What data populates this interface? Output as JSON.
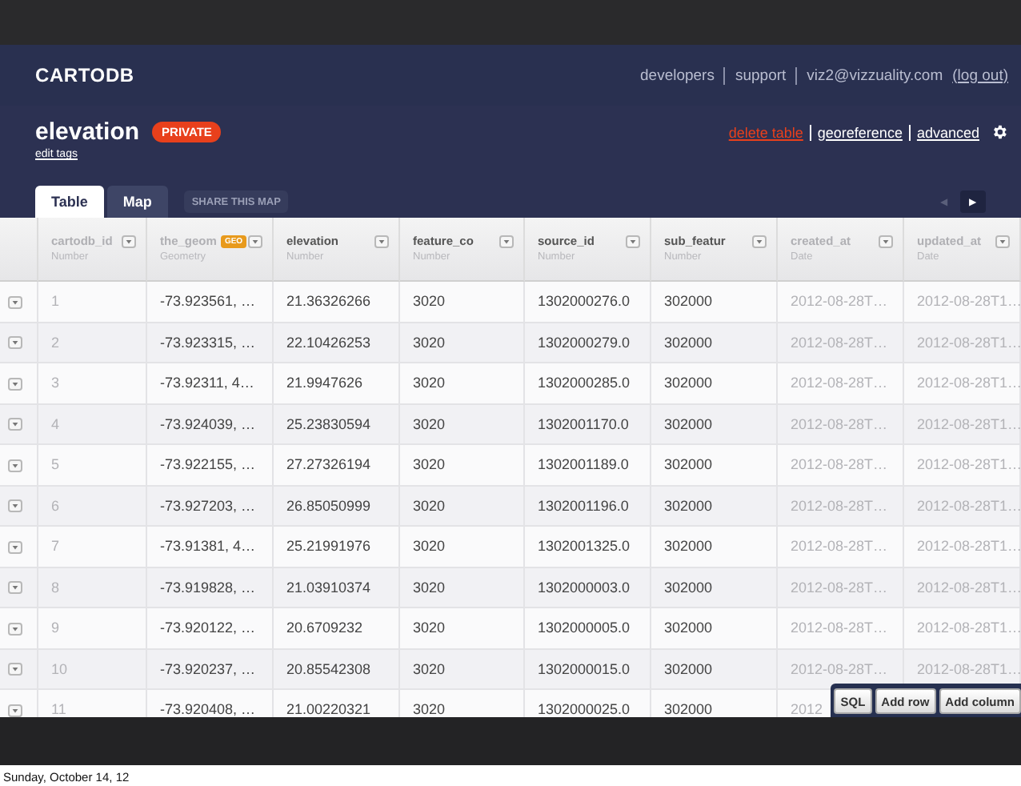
{
  "header": {
    "logo": "CARTODB",
    "nav": [
      {
        "label": "developers",
        "kind": "link"
      },
      {
        "label": "support",
        "kind": "link"
      },
      {
        "label": "viz2@vizzuality.com",
        "kind": "text"
      },
      {
        "label": "(log out)",
        "kind": "link"
      }
    ]
  },
  "table_title": "elevation",
  "privacy_badge": "PRIVATE",
  "edit_tags": "edit tags",
  "actions": [
    {
      "label": "delete table",
      "kind": "danger"
    },
    {
      "label": "georeference",
      "kind": "link"
    },
    {
      "label": "advanced",
      "kind": "link"
    }
  ],
  "tabs": [
    {
      "label": "Table",
      "selected": true
    },
    {
      "label": "Map",
      "selected": false
    }
  ],
  "share_button": "SHARE THIS MAP",
  "pager": [
    {
      "label": "◀",
      "disabled": true
    },
    {
      "label": "▶",
      "disabled": false
    }
  ],
  "columns": [
    {
      "name": "cartodb_id",
      "type": "Number",
      "readonly": true,
      "muted_values": true
    },
    {
      "name": "the_geom",
      "type": "Geometry",
      "readonly": true,
      "badge": "GEO",
      "muted_values": false
    },
    {
      "name": "elevation",
      "type": "Number",
      "readonly": false,
      "muted_values": false
    },
    {
      "name": "feature_co",
      "type": "Number",
      "readonly": false,
      "muted_values": false
    },
    {
      "name": "source_id",
      "type": "Number",
      "readonly": false,
      "muted_values": false
    },
    {
      "name": "sub_featur",
      "type": "Number",
      "readonly": false,
      "muted_values": false
    },
    {
      "name": "created_at",
      "type": "Date",
      "readonly": true,
      "muted_values": true
    },
    {
      "name": "updated_at",
      "type": "Date",
      "readonly": true,
      "muted_values": true
    }
  ],
  "rows": [
    [
      "1",
      "-73.923561, …",
      "21.36326266",
      "3020",
      "1302000276.0",
      "302000",
      "2012-08-28T…",
      "2012-08-28T1…"
    ],
    [
      "2",
      "-73.923315, …",
      "22.10426253",
      "3020",
      "1302000279.0",
      "302000",
      "2012-08-28T…",
      "2012-08-28T1…"
    ],
    [
      "3",
      "-73.92311, 4…",
      "21.9947626",
      "3020",
      "1302000285.0",
      "302000",
      "2012-08-28T…",
      "2012-08-28T1…"
    ],
    [
      "4",
      "-73.924039, …",
      "25.23830594",
      "3020",
      "1302001170.0",
      "302000",
      "2012-08-28T…",
      "2012-08-28T1…"
    ],
    [
      "5",
      "-73.922155, …",
      "27.27326194",
      "3020",
      "1302001189.0",
      "302000",
      "2012-08-28T…",
      "2012-08-28T1…"
    ],
    [
      "6",
      "-73.927203, …",
      "26.85050999",
      "3020",
      "1302001196.0",
      "302000",
      "2012-08-28T…",
      "2012-08-28T1…"
    ],
    [
      "7",
      "-73.91381, 4…",
      "25.21991976",
      "3020",
      "1302001325.0",
      "302000",
      "2012-08-28T…",
      "2012-08-28T1…"
    ],
    [
      "8",
      "-73.919828, …",
      "21.03910374",
      "3020",
      "1302000003.0",
      "302000",
      "2012-08-28T…",
      "2012-08-28T1…"
    ],
    [
      "9",
      "-73.920122, …",
      "20.6709232",
      "3020",
      "1302000005.0",
      "302000",
      "2012-08-28T…",
      "2012-08-28T1…"
    ],
    [
      "10",
      "-73.920237, …",
      "20.85542308",
      "3020",
      "1302000015.0",
      "302000",
      "2012-08-28T…",
      "2012-08-28T1…"
    ],
    [
      "11",
      "-73.920408, …",
      "21.00220321",
      "3020",
      "1302000025.0",
      "302000",
      "2012"
    ]
  ],
  "table_buttons": [
    "SQL",
    "Add row",
    "Add column"
  ],
  "footer_date": "Sunday, October 14, 12"
}
